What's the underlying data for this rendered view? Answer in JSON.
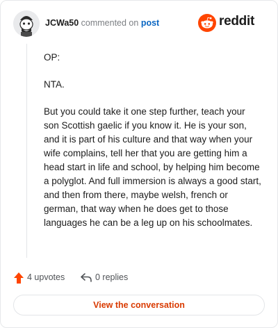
{
  "header": {
    "username": "JCWa50",
    "action_text": "commented on",
    "post_link": "post",
    "brand": "reddit",
    "brand_color": "#ff4500"
  },
  "avatar": {
    "icon": "snoo-avatar-icon"
  },
  "comment": {
    "paragraphs": [
      "OP:",
      "NTA.",
      "But you could take it one step further, teach your son Scottish gaelic if you know it. He is your son, and it is part of his culture and that way when your wife complains, tell her that you are getting him a head start in life and school, by helping him become a polyglot. And full immersion is always a good start, and then from there, maybe welsh, french or german, that way when he does get to those languages he can be a leg up on his schoolmates."
    ]
  },
  "actions": {
    "upvotes": "4 upvotes",
    "upvote_icon": "upvote-arrow-icon",
    "upvote_color": "#ff4500",
    "replies": "0 replies",
    "reply_icon": "reply-arrow-icon"
  },
  "footer": {
    "button_label": "View the conversation",
    "button_color": "#d93a00"
  }
}
